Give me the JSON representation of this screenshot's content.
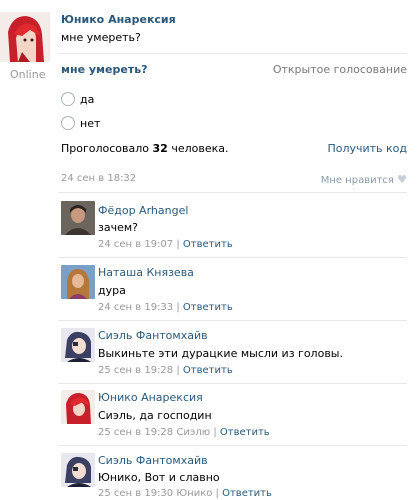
{
  "post": {
    "author": "Юнико Анарексия",
    "text": "мне умереть?",
    "online_label": "Online"
  },
  "poll": {
    "title": "мне умереть?",
    "type": "Открытое голосование",
    "options": [
      "да",
      "нет"
    ],
    "voted_prefix": "Проголосовало ",
    "voted_count": "32",
    "voted_suffix": " человека.",
    "get_code": "Получить код",
    "date": "24 сен в 18:32",
    "like": "Мне нравится"
  },
  "comments": [
    {
      "author": "Фёдор Arhangel",
      "text": "зачем?",
      "date": "24 сен в 19:07",
      "reply_to": "",
      "reply": "Ответить"
    },
    {
      "author": "Наташа Князева",
      "text": "дура",
      "date": "24 сен в 19:33",
      "reply_to": "",
      "reply": "Ответить"
    },
    {
      "author": "Сиэль Фантомхайв",
      "text": "Выкиньте эти дурацкие мысли из головы.",
      "date": "25 сен в 19:28",
      "reply_to": "",
      "reply": "Ответить"
    },
    {
      "author": "Юнико Анарексия",
      "text": "Сиэль, да господин",
      "date": "25 сен в 19:28",
      "reply_to": "Сиэлю",
      "reply": "Ответить"
    },
    {
      "author": "Сиэль Фантомхайв",
      "text": "Юнико, Вот и славно",
      "date": "25 сен в 19:30",
      "reply_to": "Юнико",
      "reply": "Ответить"
    }
  ],
  "colors": {
    "link": "#2B587A",
    "meta": "#999999",
    "divider": "#e7eaed"
  }
}
